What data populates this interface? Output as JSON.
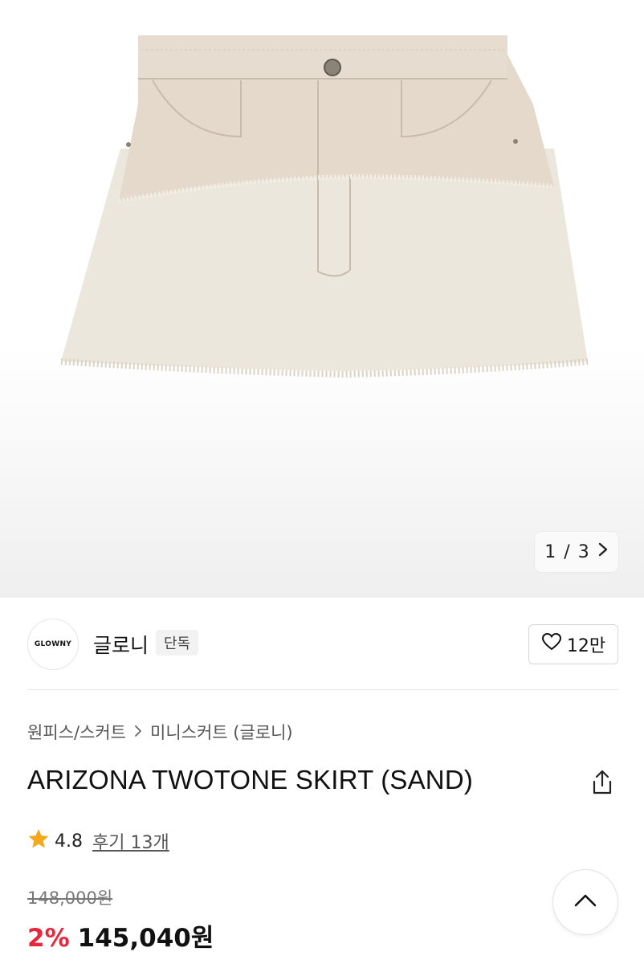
{
  "gallery": {
    "current": "1",
    "separator": "/",
    "total": "3",
    "next_icon": "chevron-right-icon"
  },
  "brand": {
    "logo_text": "GLOWNY",
    "name": "글로니",
    "badge": "단독",
    "likes": "12만"
  },
  "breadcrumb": {
    "parent": "원피스/스커트",
    "child": "미니스커트 (글로니)"
  },
  "product": {
    "title": "ARIZONA TWOTONE SKIRT (SAND)"
  },
  "rating": {
    "score": "4.8",
    "reviews": "후기 13개"
  },
  "price": {
    "original": "148,000원",
    "discount": "2%",
    "sale": "145,040원"
  },
  "colors": {
    "discount": "#e8273c",
    "star": "#f4a91c"
  }
}
